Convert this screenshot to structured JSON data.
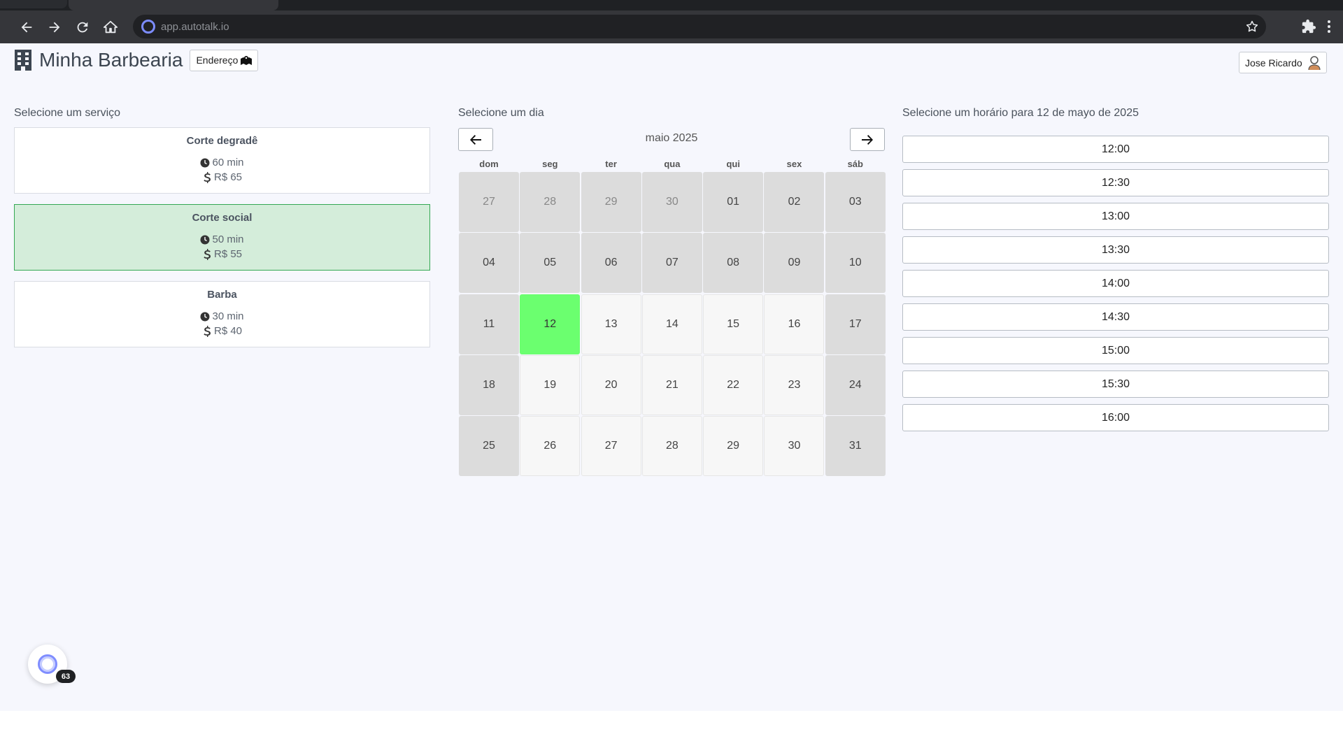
{
  "browser": {
    "url": "app.autotalk.io"
  },
  "header": {
    "title": "Minha Barbearia",
    "address_label": "Endereço",
    "user_name": "Jose Ricardo"
  },
  "services": {
    "heading": "Selecione um serviço",
    "items": [
      {
        "name": "Corte degradê",
        "duration": "60 min",
        "price": "R$ 65"
      },
      {
        "name": "Corte social",
        "duration": "50 min",
        "price": "R$ 55"
      },
      {
        "name": "Barba",
        "duration": "30 min",
        "price": "R$ 40"
      }
    ],
    "selected_index": 1
  },
  "calendar": {
    "heading": "Selecione um dia",
    "month_label": "maio 2025",
    "weekdays": [
      "dom",
      "seg",
      "ter",
      "qua",
      "qui",
      "sex",
      "sáb"
    ],
    "days": [
      {
        "label": "27",
        "state": "out"
      },
      {
        "label": "28",
        "state": "out"
      },
      {
        "label": "29",
        "state": "out"
      },
      {
        "label": "30",
        "state": "out"
      },
      {
        "label": "01",
        "state": "disabled"
      },
      {
        "label": "02",
        "state": "disabled"
      },
      {
        "label": "03",
        "state": "disabled"
      },
      {
        "label": "04",
        "state": "disabled"
      },
      {
        "label": "05",
        "state": "disabled"
      },
      {
        "label": "06",
        "state": "disabled"
      },
      {
        "label": "07",
        "state": "disabled"
      },
      {
        "label": "08",
        "state": "disabled"
      },
      {
        "label": "09",
        "state": "disabled"
      },
      {
        "label": "10",
        "state": "disabled"
      },
      {
        "label": "11",
        "state": "disabled"
      },
      {
        "label": "12",
        "state": "selected"
      },
      {
        "label": "13",
        "state": "avail"
      },
      {
        "label": "14",
        "state": "avail"
      },
      {
        "label": "15",
        "state": "avail"
      },
      {
        "label": "16",
        "state": "avail"
      },
      {
        "label": "17",
        "state": "disabled"
      },
      {
        "label": "18",
        "state": "disabled"
      },
      {
        "label": "19",
        "state": "avail"
      },
      {
        "label": "20",
        "state": "avail"
      },
      {
        "label": "21",
        "state": "avail"
      },
      {
        "label": "22",
        "state": "avail"
      },
      {
        "label": "23",
        "state": "avail"
      },
      {
        "label": "24",
        "state": "disabled"
      },
      {
        "label": "25",
        "state": "disabled"
      },
      {
        "label": "26",
        "state": "avail"
      },
      {
        "label": "27",
        "state": "avail"
      },
      {
        "label": "28",
        "state": "avail"
      },
      {
        "label": "29",
        "state": "avail"
      },
      {
        "label": "30",
        "state": "avail"
      },
      {
        "label": "31",
        "state": "disabled"
      }
    ]
  },
  "times": {
    "heading": "Selecione um horário para 12 de mayo de 2025",
    "slots": [
      "12:00",
      "12:30",
      "13:00",
      "13:30",
      "14:00",
      "14:30",
      "15:00",
      "15:30",
      "16:00"
    ]
  },
  "widget": {
    "badge": "63"
  },
  "colors": {
    "selected_service_bg": "#d4edda",
    "selected_service_border": "#34a853",
    "selected_day": "#6bff6f",
    "page_bg": "#f6f7fd"
  }
}
